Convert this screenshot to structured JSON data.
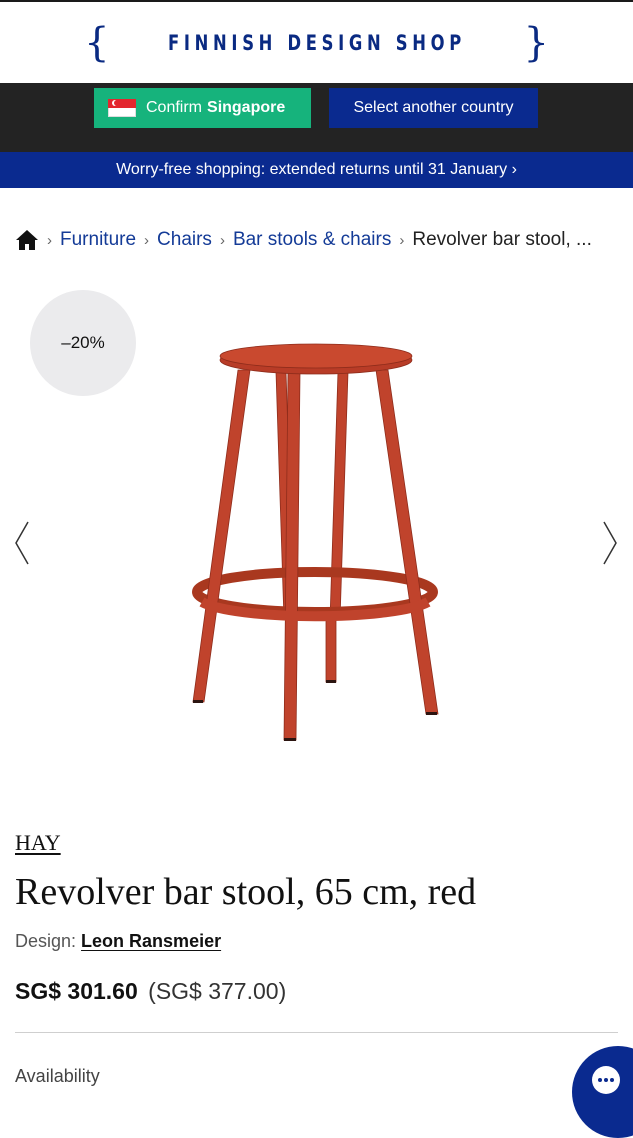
{
  "header": {
    "logo_text": "FINNISH DESIGN SHOP",
    "brace_left": "{",
    "brace_right": "}"
  },
  "country_bar": {
    "confirm_prefix": "Confirm",
    "confirm_country": "Singapore",
    "other_label": "Select another country"
  },
  "promo": {
    "text": "Worry-free shopping: extended returns until 31 January ›"
  },
  "breadcrumb": {
    "items": [
      "Furniture",
      "Chairs",
      "Bar stools & chairs"
    ],
    "current": "Revolver bar stool, ...",
    "separator": "›"
  },
  "product": {
    "discount_badge": "–20%",
    "brand": "HAY",
    "title": "Revolver bar stool, 65 cm, red",
    "designer_label": "Design:",
    "designer_name": "Leon Ransmeier",
    "price_current": "SG$ 301.60",
    "price_original": "(SG$ 377.00)",
    "availability_label": "Availability"
  },
  "colors": {
    "brand_blue": "#0a2a8f",
    "confirm_green": "#16b37c",
    "dark_bar": "#232323",
    "stool_red": "#c0432c"
  }
}
